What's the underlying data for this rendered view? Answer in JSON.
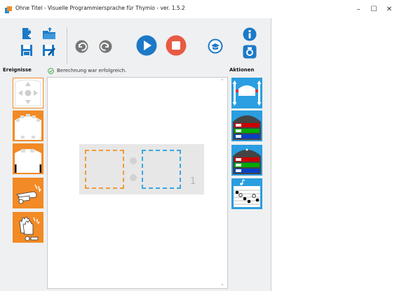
{
  "window": {
    "title": "Ohne Titel - Visuelle Programmiersprache für Thymio - ver. 1.5.2",
    "minimize_glyph": "–",
    "maximize_glyph": "☐",
    "close_glyph": "✕"
  },
  "toolbar": {
    "icons": [
      "new-file-icon",
      "open-folder-icon",
      "save-icon",
      "save-as-icon",
      "undo-icon",
      "redo-icon",
      "run-icon",
      "stop-icon",
      "advanced-mode-icon",
      "info-icon",
      "screenshot-icon"
    ]
  },
  "sidebar_left": {
    "heading": "Ereignisse",
    "blocks": [
      "buttons-event",
      "prox-front-event",
      "prox-ground-event",
      "tap-event",
      "clap-event"
    ]
  },
  "sidebar_right": {
    "heading": "Aktionen",
    "blocks": [
      "motors-action",
      "top-color-action",
      "bottom-color-action",
      "music-action"
    ]
  },
  "status": {
    "message": "Berechnung war erfolgreich."
  },
  "program": {
    "pair_number": "1"
  },
  "colors": {
    "event_orange": "#f28a26",
    "action_blue": "#2a9ee0",
    "run_blue": "#1d79c7",
    "stop_red": "#e85a43"
  }
}
